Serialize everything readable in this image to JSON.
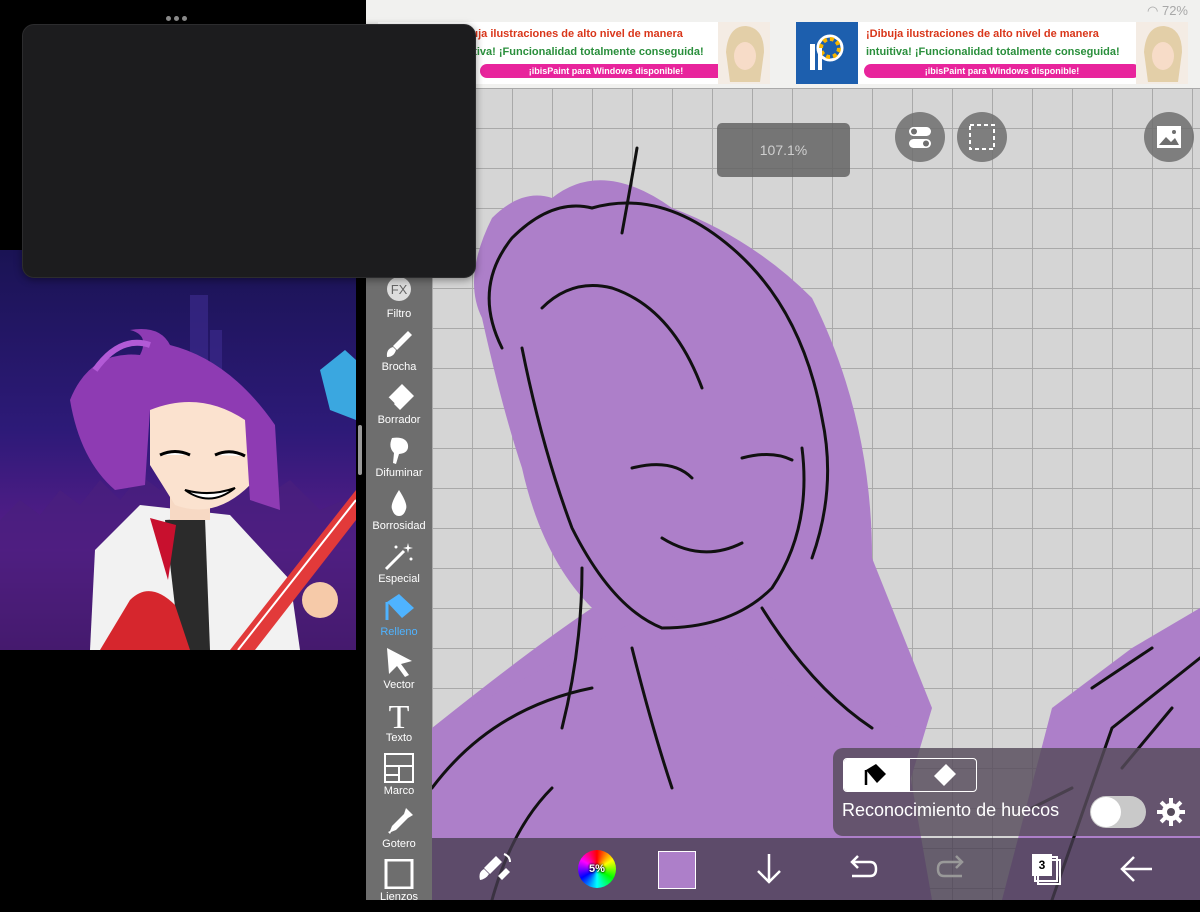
{
  "status": {
    "battery": "72%"
  },
  "ads": [
    {
      "line1": "¡Dibuja ilustraciones de alto nivel de manera",
      "line2": "intuitiva! ¡Funcionalidad totalmente conseguida!",
      "pill": "¡ibisPaint para Windows disponible!"
    },
    {
      "line1": "¡Dibuja ilustraciones de alto nivel de manera",
      "line2": "intuitiva! ¡Funcionalidad totalmente conseguida!",
      "pill": "¡ibisPaint para Windows disponible!"
    }
  ],
  "zoom": "107.1%",
  "tools": [
    {
      "label": "Filtro",
      "icon": "fx-icon"
    },
    {
      "label": "Brocha",
      "icon": "brush-icon"
    },
    {
      "label": "Borrador",
      "icon": "eraser-icon"
    },
    {
      "label": "Difuminar",
      "icon": "smudge-icon"
    },
    {
      "label": "Borrosidad",
      "icon": "blur-drop-icon"
    },
    {
      "label": "Especial",
      "icon": "special-wand-icon"
    },
    {
      "label": "Relleno",
      "icon": "fill-bucket-icon",
      "active": true
    },
    {
      "label": "Vector",
      "icon": "vector-cursor-icon"
    },
    {
      "label": "Texto",
      "icon": "text-icon"
    },
    {
      "label": "Marco",
      "icon": "frame-icon"
    },
    {
      "label": "Gotero",
      "icon": "eyedropper-icon"
    },
    {
      "label": "Lienzos",
      "icon": "canvas-icon"
    }
  ],
  "fill_options": {
    "gap_label": "Reconocimiento de huecos",
    "gap_enabled": false,
    "mode": "fill"
  },
  "bottom_bar": {
    "brush_size": "5%",
    "current_color": "#ad7fc9",
    "layer_count": "3"
  },
  "colors": {
    "accent": "#4fb3ff",
    "fill_purple": "#ad7fc9",
    "toolbar": "#6e6e6e",
    "ad_pink": "#e8249c"
  }
}
